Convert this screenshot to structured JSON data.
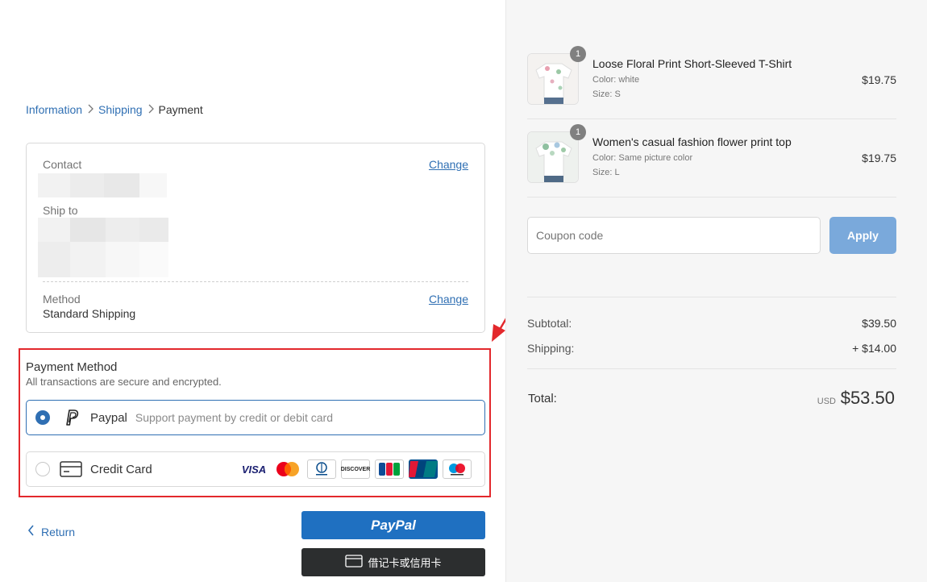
{
  "breadcrumb": {
    "items": [
      "Information",
      "Shipping",
      "Payment"
    ],
    "separator": ">"
  },
  "info": {
    "contact_label": "Contact",
    "ship_to_label": "Ship to",
    "method_label": "Method",
    "method_value": "Standard Shipping",
    "change_label": "Change"
  },
  "payment": {
    "title": "Payment Method",
    "subtitle": "All transactions are secure and encrypted.",
    "paypal_label": "Paypal",
    "paypal_desc": "Support payment by credit or debit card",
    "card_label": "Credit Card",
    "card_logos": [
      "VISA",
      "Mastercard",
      "Diners Club",
      "DISCOVER",
      "JCB",
      "UnionPay",
      "Maestro"
    ]
  },
  "buttons": {
    "return_label": "Return",
    "paypal_label": "PayPal",
    "debit_label": "借记卡或信用卡"
  },
  "products": [
    {
      "name": "Loose Floral Print Short-Sleeved T-Shirt",
      "color_label": "Color:",
      "color": "white",
      "size_label": "Size:",
      "size": "S",
      "price": "$19.75",
      "qty": "1"
    },
    {
      "name": "Women's casual fashion flower print top",
      "color_label": "Color:",
      "color": "Same picture color",
      "size_label": "Size:",
      "size": "L",
      "price": "$19.75",
      "qty": "1"
    }
  ],
  "coupon": {
    "placeholder": "Coupon code",
    "apply_label": "Apply"
  },
  "summary": {
    "subtotal_label": "Subtotal:",
    "subtotal_value": "$39.50",
    "shipping_label": "Shipping:",
    "shipping_value": "+ $14.00",
    "total_label": "Total:",
    "currency": "USD",
    "total_value": "$53.50"
  },
  "colors": {
    "accent": "#2f6fb3",
    "highlight": "#e3282c",
    "paypal_button": "#1f70c1",
    "apply_button": "#7aa9db"
  }
}
